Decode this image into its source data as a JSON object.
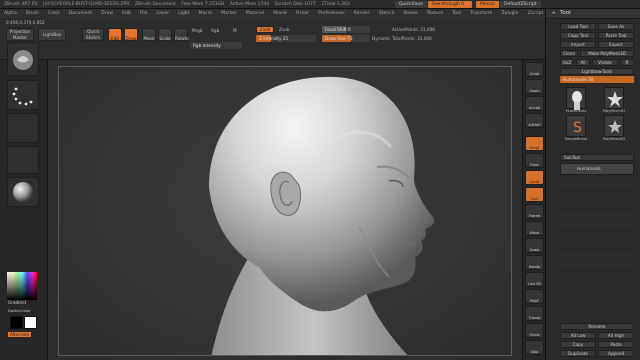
{
  "titlebar": {
    "app": "ZBrush 4R7  P3",
    "file": "[id:Q]:PEOPLE-BUST-QUAD-SEEDS.ZPR",
    "document": "ZBrush Document",
    "mem": "Free Mem 7.251GB",
    "active_mem": "Active Mem 1744",
    "scratch": "Scratch Disk 1077",
    "ztime": "ZTime 1.363",
    "quicksave_label": "QuickSave",
    "see_through_label": "See-through  0",
    "menus_label": "Menus",
    "default_zscript_label": "DefaultZScript"
  },
  "menubar": {
    "items": [
      "Alpha",
      "Brush",
      "Color",
      "Document",
      "Draw",
      "Edit",
      "File",
      "Layer",
      "Light",
      "Macro",
      "Marker",
      "Material",
      "Movie",
      "Picker",
      "Preferences",
      "Render",
      "Stencil",
      "Stroke",
      "Texture",
      "Tool",
      "Transform",
      "Zplugin",
      "Zscript"
    ]
  },
  "shelf": {
    "coords": "0.456,0.379,0.852",
    "projection_master": "Projection Master",
    "lightbox": "LightBox",
    "quick_sketch": "Quick Sketch",
    "edit": "Edit",
    "draw": "Draw",
    "move": "Move",
    "scale": "Scale",
    "rotate": "Rotate",
    "mrgb": "Mrgb",
    "rgb": "Rgb",
    "m": "M",
    "rgb_intensity": "Rgb Intensity",
    "zadd": "Zadd",
    "zsub": "Zsub",
    "z_intensity": "Z Intensity 25",
    "focal_shift": "Focal Shift 0",
    "draw_size": "Draw Size 73",
    "dynamic": "Dynamic",
    "active_points": "ActivePoints: 31,006",
    "total_points": "TotalPoints: 31,006"
  },
  "lefttray": {
    "gradient": "Gradient",
    "switchcolor": "SwitchColor",
    "alternate": "Alternate",
    "colors": {
      "main": "#000000",
      "secondary": "#ffffff",
      "accent": "#e3762b"
    }
  },
  "canvas": {
    "icon": "male-bust-sculpt"
  },
  "rightstrip": {
    "buttons": [
      "Scroll",
      "Zoom",
      "Actual",
      "AAHalf",
      "Persp",
      "Floor",
      "Local",
      "Sym",
      "Frame",
      "Move",
      "Scale",
      "Rotate",
      "Line Fill",
      "PolyF",
      "Transp",
      "Ghost",
      "Solo",
      "Xpose"
    ]
  },
  "tool": {
    "title": "Tool",
    "load_tool": "Load Tool",
    "save_as": "Save As",
    "copy_tool": "Copy Tool",
    "paste_tool": "Paste Tool",
    "import": "Import",
    "export": "Export",
    "clone": "Clone",
    "make_polymesh": "Make PolyMesh3D",
    "goz": "GoZ",
    "all": "All",
    "visible": "Visible",
    "r": "R",
    "lightbox_tools": "Lightbox▸Tools",
    "current_tool": "Humanoids  50",
    "thumbnails": [
      "Humanoids",
      "PolyMesh3D",
      "SimpleBrush",
      "PolyMesh3D"
    ],
    "subtool": "SubTool",
    "subtool_item": "Humanoids",
    "rename": "Rename",
    "all_low": "All Low",
    "all_high": "All High",
    "copy": "Copy",
    "paste": "Paste",
    "duplicate": "Duplicate",
    "append": "Append"
  }
}
